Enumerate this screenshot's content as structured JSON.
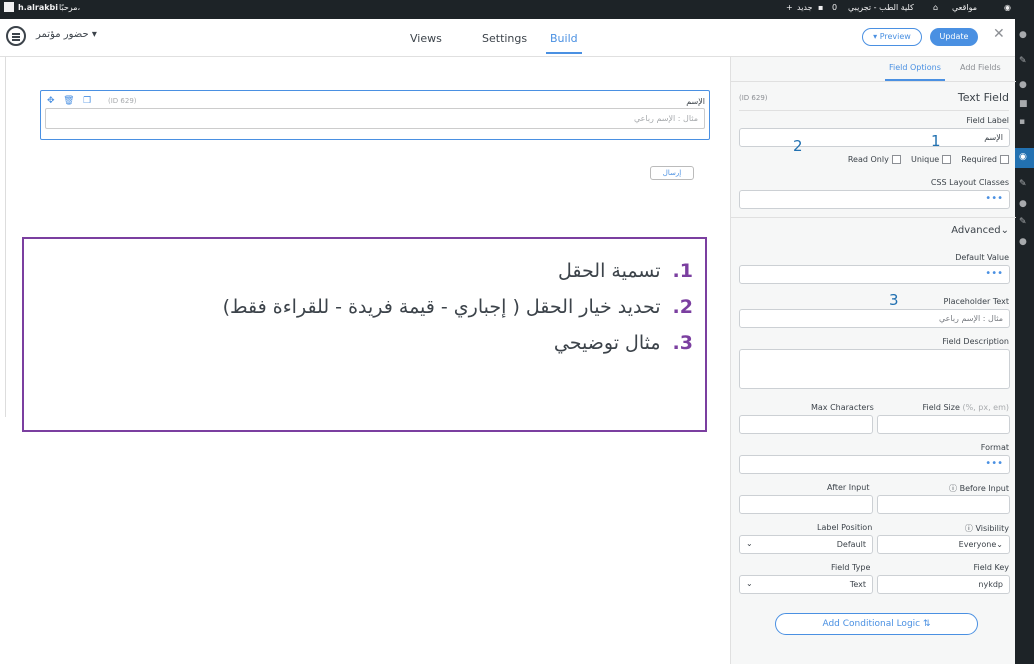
{
  "adminbar": {
    "site": "h.alrakbi",
    "greeting": "مرحبًا،",
    "site_name": "كلية الطب - تجريبي",
    "comments": "0",
    "new_label": "جديد",
    "wordpress_label": "مواقعي"
  },
  "header": {
    "form_title": "حضور مؤتمر",
    "tabs": [
      "Views",
      "Settings",
      "Build"
    ],
    "active_tab": "Build",
    "preview_label": "Preview",
    "update_label": "Update"
  },
  "canvas": {
    "field_id": "(ID 629)",
    "field_label": "الإسم",
    "placeholder": "مثال : الإسم رباعي",
    "submit_label": "إرسال"
  },
  "panel": {
    "tabs": [
      "Field Options",
      "Add Fields"
    ],
    "field_id": "(ID 629)",
    "field_type_title": "Text Field",
    "field_label_label": "Field Label",
    "field_label_value": "الإسم",
    "checkboxes": [
      "Read Only",
      "Unique",
      "Required"
    ],
    "css_classes_label": "CSS Layout Classes",
    "advanced_label": "Advanced",
    "default_value_label": "Default Value",
    "placeholder_label": "Placeholder Text",
    "placeholder_value": "مثال : الإسم رباعي",
    "description_label": "Field Description",
    "max_chars_label": "Max Characters",
    "field_size_label": "Field Size",
    "field_size_hint": "(%, px, em)",
    "format_label": "Format",
    "after_input_label": "After Input",
    "before_input_label": "Before Input",
    "label_position_label": "Label Position",
    "label_position_value": "Default",
    "visibility_label": "Visibility",
    "visibility_value": "Everyone",
    "field_type_label": "Field Type",
    "field_type_value": "Text",
    "field_key_label": "Field Key",
    "field_key_value": "nykdp",
    "conditional_logic_label": "Add Conditional Logic"
  },
  "annotations": [
    "1",
    "2",
    "3"
  ],
  "callout": {
    "items": [
      {
        "num": "1.",
        "text": "تسمية الحقل"
      },
      {
        "num": "2.",
        "text": "تحديد خيار الحقل ( إجباري - قيمة فريدة - للقراءة فقط)"
      },
      {
        "num": "3.",
        "text": "مثال توضيحي"
      }
    ]
  },
  "colors": {
    "accent": "#4a90e2",
    "callout_border": "#7b3fa0",
    "adminbar": "#1d2327"
  }
}
